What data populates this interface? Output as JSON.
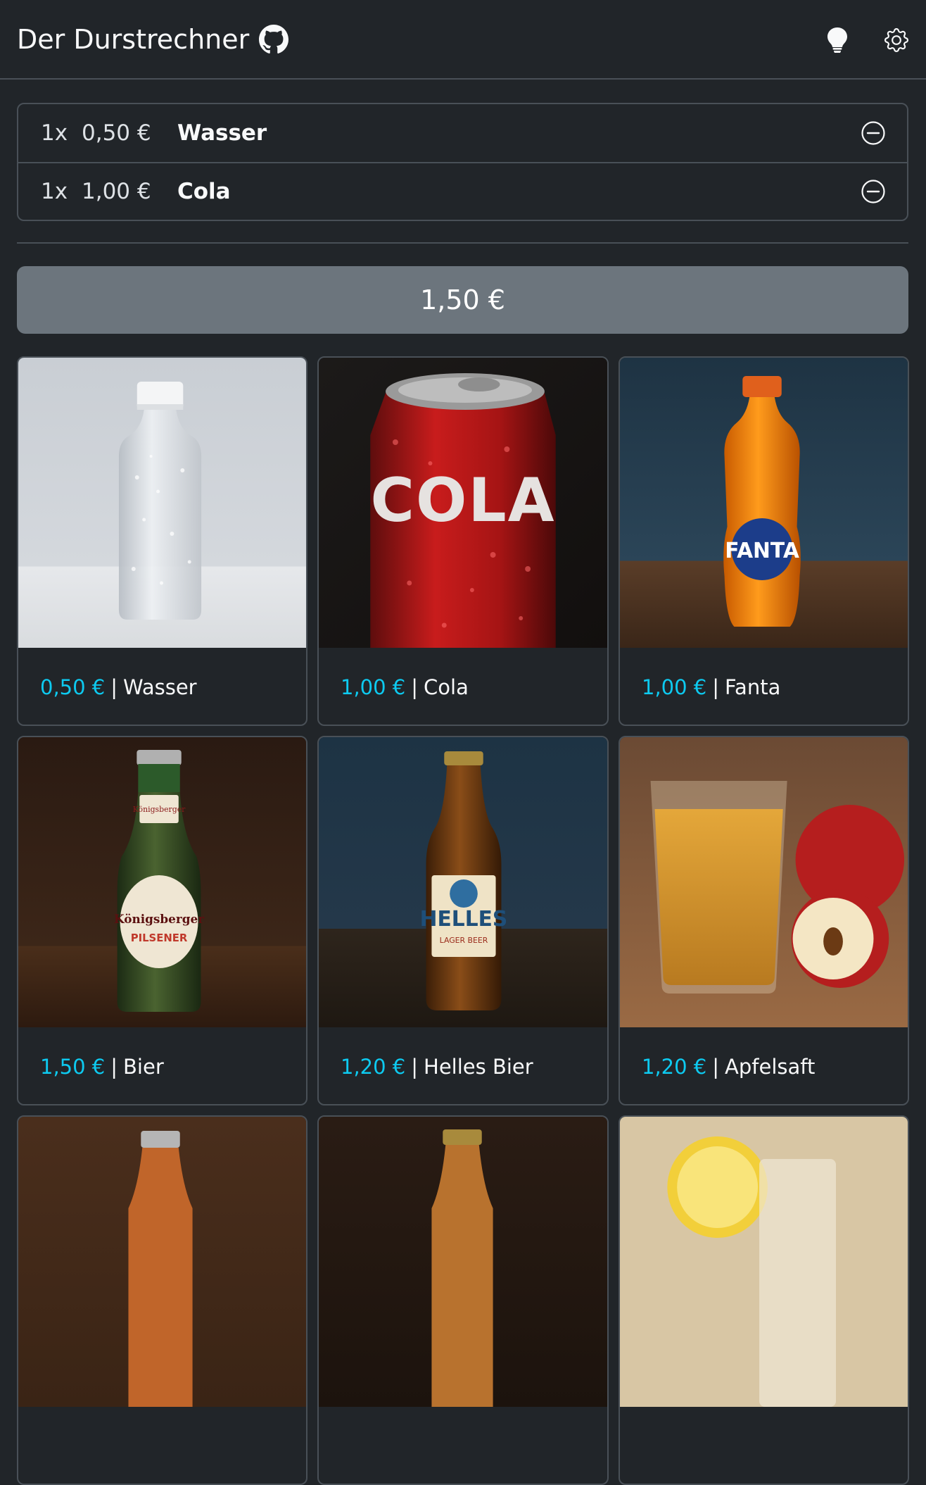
{
  "header": {
    "title": "Der Durstrechner",
    "github_icon": "github-icon",
    "theme_icon": "lightbulb-icon",
    "settings_icon": "gear-icon"
  },
  "order": {
    "items": [
      {
        "qty": "1x",
        "price": "0,50 €",
        "name": "Wasser"
      },
      {
        "qty": "1x",
        "price": "1,00 €",
        "name": "Cola"
      }
    ],
    "remove_icon": "dash-circle-icon"
  },
  "total": "1,50 €",
  "products": [
    {
      "price": "0,50 €",
      "separator": "|",
      "name": "Wasser"
    },
    {
      "price": "1,00 €",
      "separator": "|",
      "name": "Cola"
    },
    {
      "price": "1,00 €",
      "separator": "|",
      "name": "Fanta"
    },
    {
      "price": "1,50 €",
      "separator": "|",
      "name": "Bier"
    },
    {
      "price": "1,20 €",
      "separator": "|",
      "name": "Helles Bier"
    },
    {
      "price": "1,20 €",
      "separator": "|",
      "name": "Apfelsaft"
    },
    {
      "price": "",
      "separator": "",
      "name": ""
    },
    {
      "price": "",
      "separator": "",
      "name": ""
    },
    {
      "price": "",
      "separator": "",
      "name": ""
    }
  ],
  "product_images": {
    "0": {
      "cola_text": ""
    },
    "1": {
      "can_text": "COLA"
    },
    "2": {
      "logo_text": "FANTA"
    },
    "3": {
      "label_top": "Königsberger",
      "label_main": "Königsberger",
      "label_sub": "PILSENER"
    },
    "4": {
      "label_main": "HELLES",
      "label_sub": "LAGER BEER"
    }
  },
  "colors": {
    "background": "#212529",
    "border": "#495057",
    "total_bg": "#6c757d",
    "price_accent": "#0dcaf0"
  }
}
